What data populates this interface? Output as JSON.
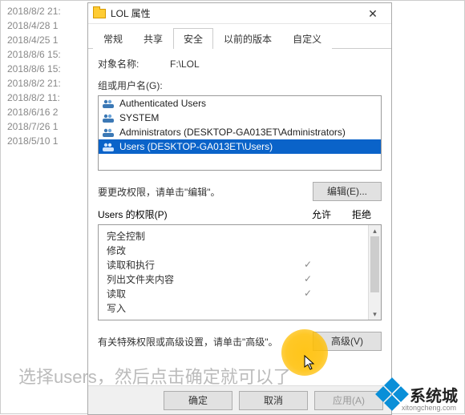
{
  "background_list": [
    "2018/8/2 21:",
    "2018/4/28 1",
    "2018/4/25 1",
    "2018/8/6 15:",
    "2018/8/6 15:",
    "2018/8/2 21:",
    "2018/8/2 11:",
    "2018/6/16 2",
    "2018/7/26 1",
    "2018/5/10 1"
  ],
  "dialog": {
    "title": "LOL 属性",
    "tabs": [
      "常规",
      "共享",
      "安全",
      "以前的版本",
      "自定义"
    ],
    "active_tab": 2,
    "object_label": "对象名称:",
    "object_value": "F:\\LOL",
    "group_label": "组或用户名(G):",
    "groups": [
      {
        "name": "Authenticated Users",
        "selected": false
      },
      {
        "name": "SYSTEM",
        "selected": false
      },
      {
        "name": "Administrators (DESKTOP-GA013ET\\Administrators)",
        "selected": false
      },
      {
        "name": "Users (DESKTOP-GA013ET\\Users)",
        "selected": true
      }
    ],
    "edit_hint": "要更改权限，请单击\"编辑\"。",
    "edit_btn": "编辑(E)...",
    "perm_label": "Users 的权限(P)",
    "perm_allow": "允许",
    "perm_deny": "拒绝",
    "permissions": [
      {
        "name": "完全控制",
        "allow": false,
        "deny": false
      },
      {
        "name": "修改",
        "allow": false,
        "deny": false
      },
      {
        "name": "读取和执行",
        "allow": true,
        "deny": false
      },
      {
        "name": "列出文件夹内容",
        "allow": true,
        "deny": false
      },
      {
        "name": "读取",
        "allow": true,
        "deny": false
      },
      {
        "name": "写入",
        "allow": false,
        "deny": false
      }
    ],
    "adv_hint": "有关特殊权限或高级设置，请单击\"高级\"。",
    "adv_btn": "高级(V)",
    "ok_btn": "确定",
    "cancel_btn": "取消",
    "apply_btn": "应用(A)"
  },
  "overlay_instruction": "选择users，然后点击确定就可以了",
  "logo": {
    "text": "系统城",
    "url": "xitongcheng.com"
  }
}
